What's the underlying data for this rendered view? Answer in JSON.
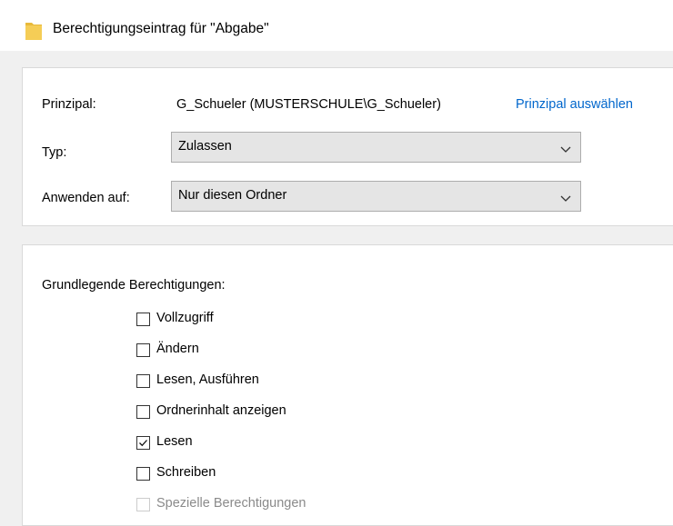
{
  "window": {
    "title": "Berechtigungseintrag für \"Abgabe\""
  },
  "principal": {
    "label": "Prinzipal:",
    "value": "G_Schueler (MUSTERSCHULE\\G_Schueler)",
    "select_link": "Prinzipal auswählen"
  },
  "type": {
    "label": "Typ:",
    "selected": "Zulassen"
  },
  "apply_to": {
    "label": "Anwenden auf:",
    "selected": "Nur diesen Ordner"
  },
  "permissions": {
    "heading": "Grundlegende Berechtigungen:",
    "items": [
      {
        "label": "Vollzugriff",
        "checked": false,
        "enabled": true
      },
      {
        "label": "Ändern",
        "checked": false,
        "enabled": true
      },
      {
        "label": "Lesen, Ausführen",
        "checked": false,
        "enabled": true
      },
      {
        "label": "Ordnerinhalt anzeigen",
        "checked": false,
        "enabled": true
      },
      {
        "label": "Lesen",
        "checked": true,
        "enabled": true
      },
      {
        "label": "Schreiben",
        "checked": false,
        "enabled": true
      },
      {
        "label": "Spezielle Berechtigungen",
        "checked": false,
        "enabled": false
      }
    ]
  },
  "colors": {
    "link": "#0066cc",
    "folder": "#e8b93a",
    "combo_bg": "#e5e5e5",
    "disabled_text": "#8a8a8a"
  },
  "icons": {
    "title": "folder-icon",
    "combo": "chevron-down-icon",
    "checkbox": "checkmark-icon"
  }
}
